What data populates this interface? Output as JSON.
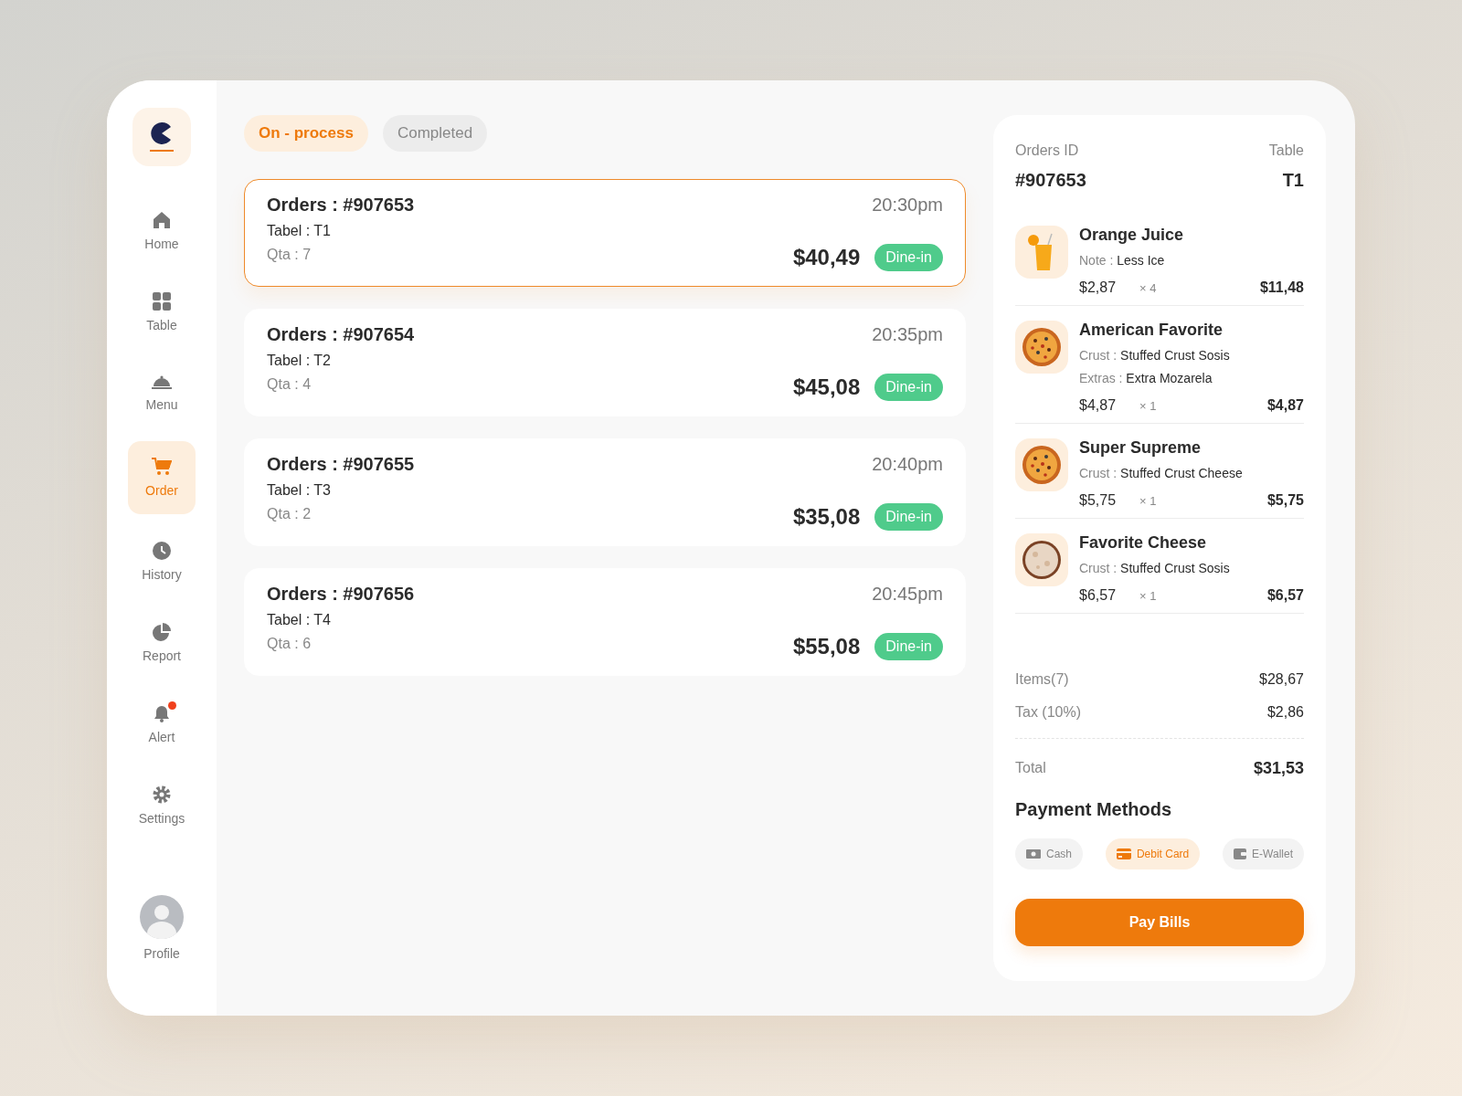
{
  "sidebar": {
    "items": [
      {
        "label": "Home",
        "selected": false,
        "notification": false
      },
      {
        "label": "Table",
        "selected": false,
        "notification": false
      },
      {
        "label": "Menu",
        "selected": false,
        "notification": false
      },
      {
        "label": "Order",
        "selected": true,
        "notification": false
      },
      {
        "label": "History",
        "selected": false,
        "notification": false
      },
      {
        "label": "Report",
        "selected": false,
        "notification": false
      },
      {
        "label": "Alert",
        "selected": false,
        "notification": true
      },
      {
        "label": "Settings",
        "selected": false,
        "notification": false
      }
    ],
    "profile": {
      "label": "Profile"
    }
  },
  "tabs": [
    {
      "label": "On - process",
      "selected": true
    },
    {
      "label": "Completed",
      "selected": false
    }
  ],
  "orders": [
    {
      "title": "Orders : #907653",
      "time": "20:30pm",
      "table": "Tabel : T1",
      "qty": "Qta : 7",
      "total": "$40,49",
      "type": "Dine-in",
      "selected": true
    },
    {
      "title": "Orders : #907654",
      "time": "20:35pm",
      "table": "Tabel : T2",
      "qty": "Qta : 4",
      "total": "$45,08",
      "type": "Dine-in",
      "selected": false
    },
    {
      "title": "Orders : #907655",
      "time": "20:40pm",
      "table": "Tabel : T3",
      "qty": "Qta : 2",
      "total": "$35,08",
      "type": "Dine-in",
      "selected": false
    },
    {
      "title": "Orders : #907656",
      "time": "20:45pm",
      "table": "Tabel : T4",
      "qty": "Qta : 6",
      "total": "$55,08",
      "type": "Dine-in",
      "selected": false
    }
  ],
  "detail": {
    "id_label": "Orders ID",
    "id": "#907653",
    "table_label": "Table",
    "table": "T1",
    "items": [
      {
        "kind": "drink",
        "name": "Orange Juice",
        "notes": [
          {
            "label": "Note :",
            "value": "Less Ice"
          }
        ],
        "price": "$2,87",
        "qty": "× 4",
        "subtotal": "$11,48"
      },
      {
        "kind": "pizza",
        "name": "American Favorite",
        "notes": [
          {
            "label": "Crust :",
            "value": "Stuffed Crust Sosis"
          },
          {
            "label": "Extras :",
            "value": "Extra Mozarela"
          }
        ],
        "price": "$4,87",
        "qty": "× 1",
        "subtotal": "$4,87"
      },
      {
        "kind": "pizza",
        "name": "Super Supreme",
        "notes": [
          {
            "label": "Crust :",
            "value": "Stuffed Crust Cheese"
          }
        ],
        "price": "$5,75",
        "qty": "× 1",
        "subtotal": "$5,75"
      },
      {
        "kind": "cheese",
        "name": "Favorite Cheese",
        "notes": [
          {
            "label": "Crust :",
            "value": "Stuffed Crust Sosis"
          }
        ],
        "price": "$6,57",
        "qty": "× 1",
        "subtotal": "$6,57"
      }
    ],
    "summary": [
      {
        "label": "Items(7)",
        "value": "$28,67"
      },
      {
        "label": "Tax (10%)",
        "value": "$2,86"
      }
    ],
    "total": {
      "label": "Total",
      "value": "$31,53"
    },
    "payment_title": "Payment Methods",
    "payments": [
      {
        "label": "Cash",
        "selected": false
      },
      {
        "label": "Debit Card",
        "selected": true
      },
      {
        "label": "E-Wallet",
        "selected": false
      }
    ],
    "pay_button": "Pay Bills"
  }
}
